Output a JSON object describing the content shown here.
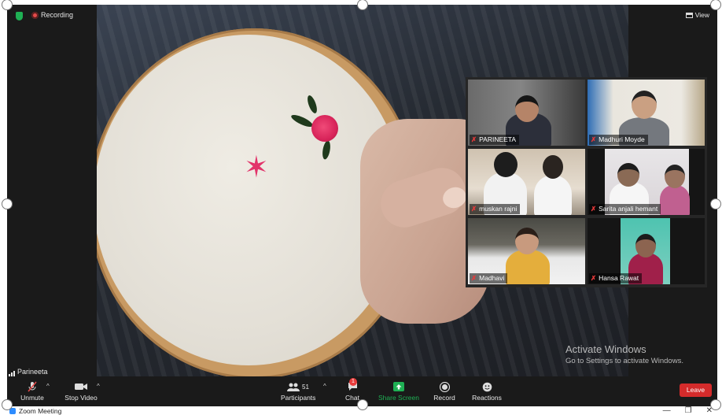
{
  "top_bar": {
    "recording_label": "Recording",
    "view_label": "View"
  },
  "gallery": {
    "participants": [
      {
        "name": "PARINEETA",
        "muted": true
      },
      {
        "name": "Madhuri Moyde",
        "muted": true
      },
      {
        "name": "muskan rajni",
        "muted": true
      },
      {
        "name": "Sarita anjali hemant",
        "muted": true
      },
      {
        "name": "Madhavi",
        "muted": true
      },
      {
        "name": "Hansa Rawat",
        "muted": true
      }
    ]
  },
  "active_speaker": {
    "name": "Parineeta"
  },
  "watermark": {
    "title": "Activate Windows",
    "subtitle": "Go to Settings to activate Windows."
  },
  "toolbar": {
    "unmute_label": "Unmute",
    "stop_video_label": "Stop Video",
    "participants_label": "Participants",
    "participants_count": "51",
    "chat_label": "Chat",
    "chat_badge": "1",
    "share_screen_label": "Share Screen",
    "record_label": "Record",
    "reactions_label": "Reactions",
    "leave_label": "Leave"
  },
  "window": {
    "title": "Zoom Meeting",
    "minimize": "—",
    "restore": "❐",
    "close": "✕"
  },
  "colors": {
    "share_green": "#1fb054",
    "leave_red": "#d42b2b",
    "background": "#1a1a1a"
  }
}
